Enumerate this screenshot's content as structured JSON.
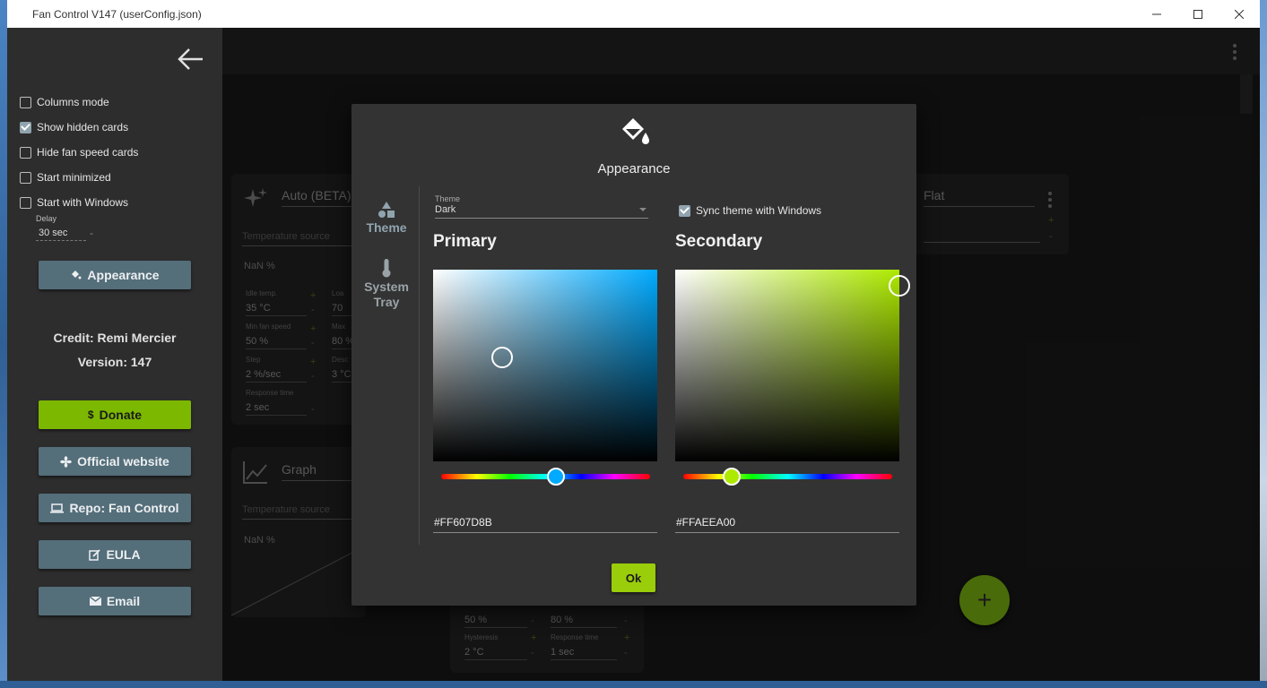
{
  "window": {
    "title": "Fan Control V147 (userConfig.json)"
  },
  "sidebar": {
    "options": [
      {
        "label": "Columns mode",
        "checked": false
      },
      {
        "label": "Show hidden cards",
        "checked": true
      },
      {
        "label": "Hide fan speed cards",
        "checked": false
      },
      {
        "label": "Start minimized",
        "checked": false
      },
      {
        "label": "Start with Windows",
        "checked": false
      }
    ],
    "delay_label": "Delay",
    "delay_value": "30 sec",
    "appearance_button": "Appearance",
    "credit": "Credit: Remi Mercier",
    "version": "Version: 147",
    "donate_button": "Donate",
    "website_button": "Official website",
    "repo_button": "Repo: Fan Control",
    "eula_button": "EULA",
    "email_button": "Email"
  },
  "cards": {
    "auto": {
      "title": "Auto (BETA)",
      "source_placeholder": "Temperature source",
      "output": "NaN %",
      "idle_temp_label": "Idle temp.",
      "idle_temp": "35 °C",
      "load_temp_label": "Loa",
      "load_temp": "70 ",
      "min_fan_label": "Min fan speed",
      "min_fan": "50 %",
      "max_fan_label": "Max",
      "max_fan": "80 %",
      "step_label": "Step",
      "step": "2 %/sec",
      "decrease_label": "Desc",
      "decrease": "3 °C",
      "response_label": "Response time",
      "response": "2 sec"
    },
    "graph": {
      "title": "Graph",
      "source_placeholder": "Temperature source",
      "output": "NaN %"
    },
    "flat": {
      "title": "Flat"
    },
    "bottom": {
      "val1": "50 %",
      "val2": "80 %",
      "hysteresis_label": "Hysteresis",
      "hysteresis": "2 °C",
      "response_label": "Response time",
      "response": "1 sec"
    }
  },
  "dialog": {
    "title": "Appearance",
    "tabs": [
      {
        "label": "Theme",
        "active": true
      },
      {
        "label": "System Tray",
        "active": false
      }
    ],
    "theme_label": "Theme",
    "theme_value": "Dark",
    "sync_label": "Sync theme with Windows",
    "sync_checked": true,
    "primary": {
      "title": "Primary",
      "hex": "#FF607D8B",
      "hue_color": "#00aaff",
      "thumb_color": "#607D8B"
    },
    "secondary": {
      "title": "Secondary",
      "hex": "#FFAEEA00",
      "hue_color": "#aeea00",
      "thumb_color": "#AEEA00"
    },
    "ok_button": "Ok"
  },
  "fab_label": "+"
}
